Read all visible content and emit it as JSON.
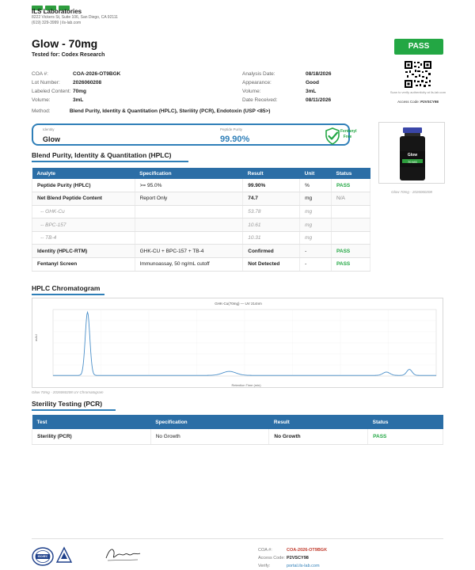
{
  "company": {
    "name": "ILS Laboratories",
    "address": "8222 Vickers St, Suite 106, San Diego, CA 92111",
    "phone": "(619) 329-3999 | ils-lab.com"
  },
  "product": {
    "title": "Glow - 70mg",
    "tested_for": "Tested for: Codex Research"
  },
  "badge": {
    "label": "PASS",
    "color": "#23a744"
  },
  "qr": {
    "caption": "Scan to verify authenticity at ils-lab.com",
    "access_label": "Access Code:",
    "access_code": "P2VSCY98"
  },
  "meta_left": [
    {
      "key": "COA #:",
      "value": "COA-2026-OT9BGK"
    },
    {
      "key": "Lot Number:",
      "value": "2026060208"
    },
    {
      "key": "Labeled Content:",
      "value": "70mg"
    },
    {
      "key": "Volume:",
      "value": "3mL"
    }
  ],
  "meta_right": [
    {
      "key": "Analysis Date:",
      "value": "08/18/2026"
    },
    {
      "key": "Appearance:",
      "value": "Good"
    },
    {
      "key": "Volume:",
      "value": "3mL"
    },
    {
      "key": "Date Received:",
      "value": "08/11/2026"
    }
  ],
  "method": {
    "key": "Method:",
    "value": "Blend Purity, Identity & Quantitation (HPLC), Sterility (PCR), Endotoxin (USP <85>)"
  },
  "summary": {
    "identity_label": "Identity",
    "identity_value": "Glow",
    "purity_label": "Peptide Purity",
    "purity_value": "99.90%",
    "fentanyl_line1": "Fentanyl",
    "fentanyl_line2": "Free"
  },
  "blend_section": {
    "title": "Blend Purity, Identity & Quantitation (HPLC)"
  },
  "blend_table": {
    "headers": [
      "Analyte",
      "Specification",
      "Result",
      "Unit",
      "Status"
    ],
    "rows": [
      {
        "analyte": "Peptide Purity (HPLC)",
        "spec": ">= 95.0%",
        "result": "99.90%",
        "unit": "%",
        "status": "PASS"
      },
      {
        "analyte": "Net Blend Peptide Content",
        "spec": "Report Only",
        "result": "74.7",
        "unit": "mg",
        "status": "N/A"
      },
      {
        "analyte": "-- GHK-Cu",
        "spec": "",
        "result": "53.78",
        "unit": "mg",
        "status": ""
      },
      {
        "analyte": "-- BPC-157",
        "spec": "",
        "result": "10.61",
        "unit": "mg",
        "status": ""
      },
      {
        "analyte": "-- TB-4",
        "spec": "",
        "result": "10.31",
        "unit": "mg",
        "status": ""
      },
      {
        "analyte": "Identity (HPLC-RTM)",
        "spec": "GHK-CU + BPC-157 + TB-4",
        "result": "Confirmed",
        "unit": "-",
        "status": "PASS"
      },
      {
        "analyte": "Fentanyl Screen",
        "spec": "Immunoassay, 50 ng/mL cutoff",
        "result": "Not Detected",
        "unit": "-",
        "status": "PASS"
      }
    ]
  },
  "vial": {
    "caption": "Glow 70mg - 2026060208",
    "label": "Glow",
    "sub": "70 MG"
  },
  "chroma_section": {
    "title": "HPLC Chromatogram",
    "chart_title": "GHK-Cu(70mg) — UV 214nm",
    "caption": "Glow 70mg - 2026060208 UV Chromatogram"
  },
  "chart_data": {
    "type": "line",
    "title": "GHK-Cu(70mg) — UV 214nm",
    "xlabel": "Retention Time (min)",
    "ylabel": "mAU",
    "peaks": [
      {
        "x": 1.8,
        "y": 0.95
      },
      {
        "x": 9.2,
        "y": 0.06
      },
      {
        "x": 17.4,
        "y": 0.05
      },
      {
        "x": 18.6,
        "y": 0.09
      }
    ],
    "xlim": [
      0,
      20
    ]
  },
  "sterility_section": {
    "title": "Sterility Testing (PCR)"
  },
  "sterility_table": {
    "headers": [
      "Test",
      "Specification",
      "Result",
      "Status"
    ],
    "rows": [
      {
        "test": "Sterility (PCR)",
        "spec": "No Growth",
        "result": "No Growth",
        "status": "PASS"
      }
    ]
  },
  "footer": {
    "coa_key": "COA #:",
    "coa_value": "COA-2026-OT9BGK",
    "access_key": "Access Code:",
    "access_value": "P2VSCY98",
    "verify_key": "Verify:",
    "verify_value": "portal.ils-lab.com",
    "seal_text": "ISO/IEC"
  }
}
